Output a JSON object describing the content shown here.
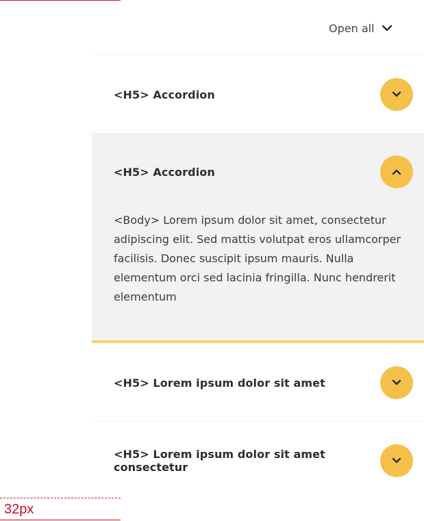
{
  "toolbar": {
    "open_all_label": "Open all",
    "open_all_icon": "chevron-down-icon"
  },
  "accordion": {
    "accent_color": "#f5c04a",
    "expanded_border_color": "#f7d26a",
    "items": [
      {
        "title": "<H5> Accordion",
        "state": "collapsed",
        "icon": "chevron-down-icon"
      },
      {
        "title": "<H5> Accordion",
        "state": "expanded",
        "icon": "chevron-up-icon",
        "body": "<Body> Lorem ipsum dolor sit amet, consectetur adipiscing elit. Sed mattis volutpat eros ullamcorper facilisis. Donec suscipit ipsum mauris. Nulla elementum orci sed lacinia fringilla. Nunc hendrerit elementum"
      },
      {
        "title": "<H5> Lorem ipsum dolor sit amet",
        "state": "collapsed",
        "icon": "chevron-down-icon"
      },
      {
        "title": "<H5> Lorem ipsum dolor sit amet consectetur",
        "state": "collapsed",
        "icon": "chevron-down-icon"
      }
    ]
  },
  "annotation": {
    "spacing_label": "32px",
    "color": "#c8102e"
  }
}
